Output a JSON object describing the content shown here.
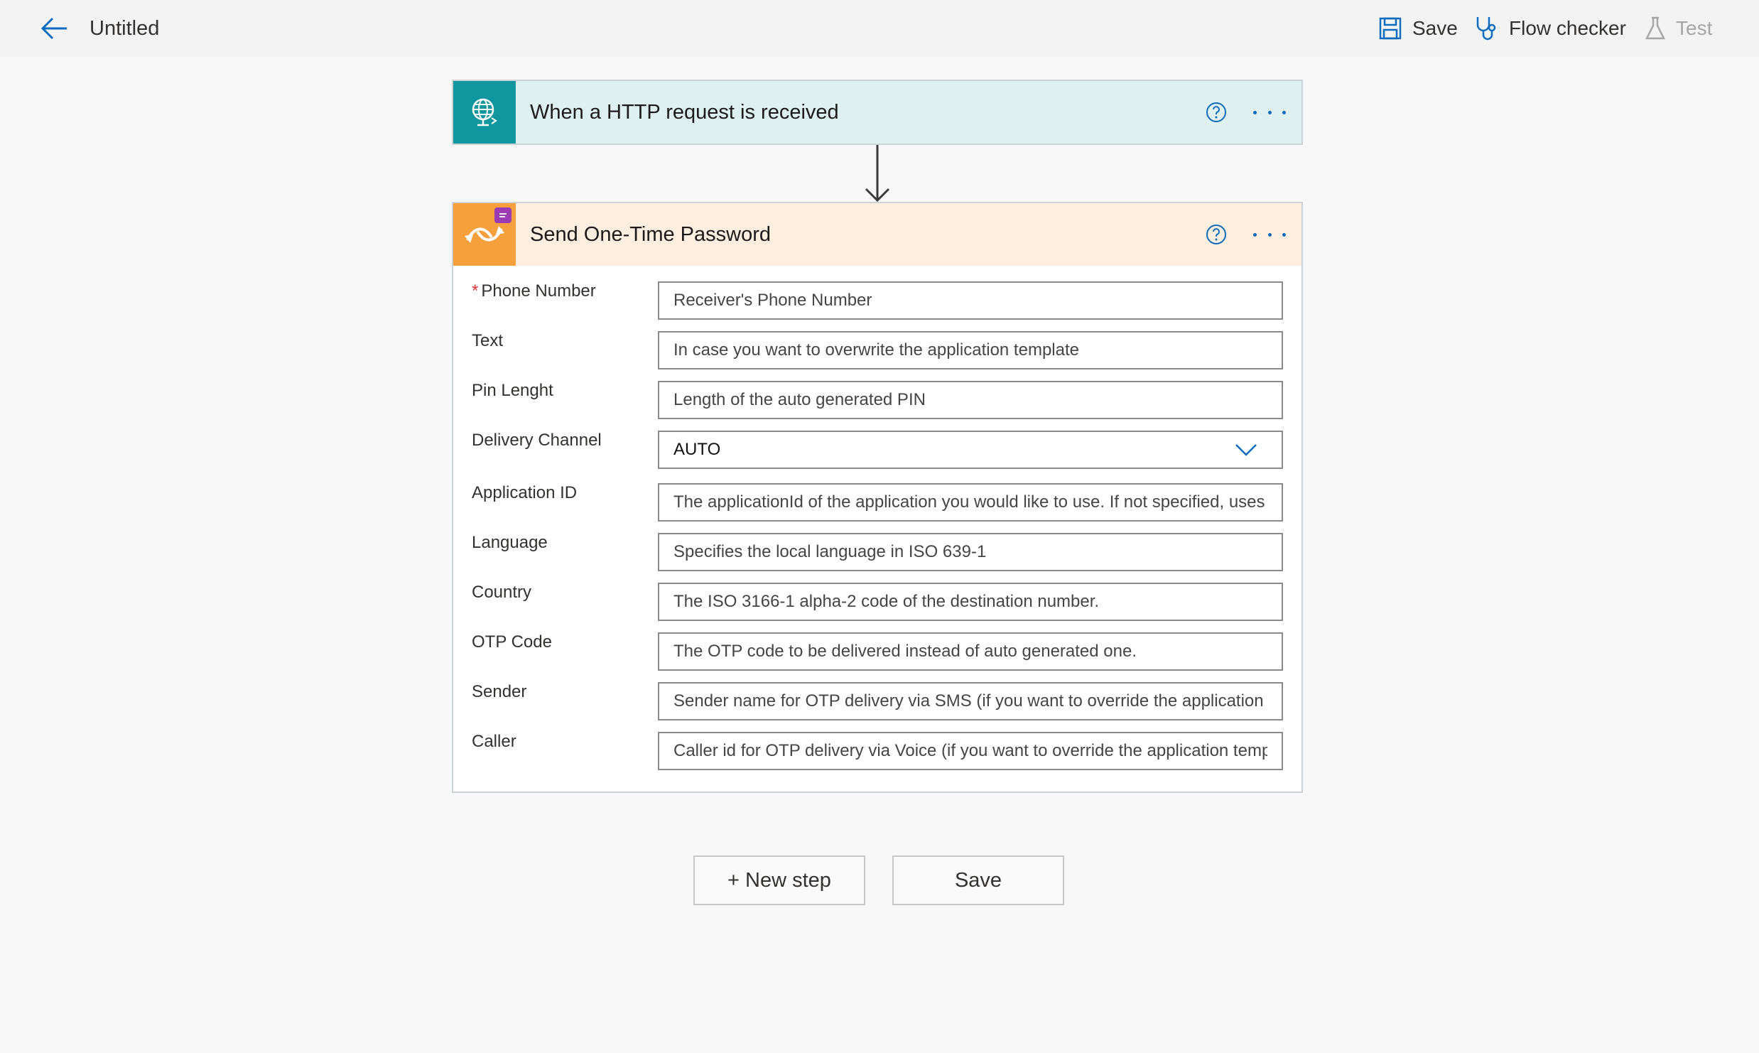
{
  "header": {
    "title": "Untitled",
    "save_label": "Save",
    "checker_label": "Flow checker",
    "test_label": "Test"
  },
  "colors": {
    "accent": "#0f6cbd",
    "trigger_bg": "#dff0f1",
    "trigger_icon": "#0f969e",
    "action_bg": "#fdeee0",
    "action_icon": "#f5a03c",
    "required": "#d13438"
  },
  "trigger": {
    "title": "When a HTTP request is received"
  },
  "action": {
    "title": "Send One-Time Password",
    "fields": [
      {
        "label": "Phone Number",
        "required": "*",
        "placeholder": "Receiver's Phone Number"
      },
      {
        "label": "Text",
        "placeholder": "In case you want to overwrite the application template"
      },
      {
        "label": "Pin Lenght",
        "placeholder": "Length of the auto generated PIN"
      },
      {
        "label": "Delivery Channel",
        "value": "AUTO"
      },
      {
        "label": "Application ID",
        "placeholder": "The applicationId of the application you would like to use. If not specified, uses"
      },
      {
        "label": "Language",
        "placeholder": "Specifies the local language in ISO 639-1"
      },
      {
        "label": "Country",
        "placeholder": "The ISO 3166-1 alpha-2 code of the destination number."
      },
      {
        "label": "OTP Code",
        "placeholder": "The OTP code to be delivered instead of auto generated one."
      },
      {
        "label": "Sender",
        "placeholder": "Sender name for OTP delivery via SMS (if you want to override the application t"
      },
      {
        "label": "Caller",
        "placeholder": "Caller id for OTP delivery via Voice (if you want to override the application temp"
      }
    ]
  },
  "footer": {
    "new_step_label": "+ New step",
    "save_label": "Save"
  }
}
